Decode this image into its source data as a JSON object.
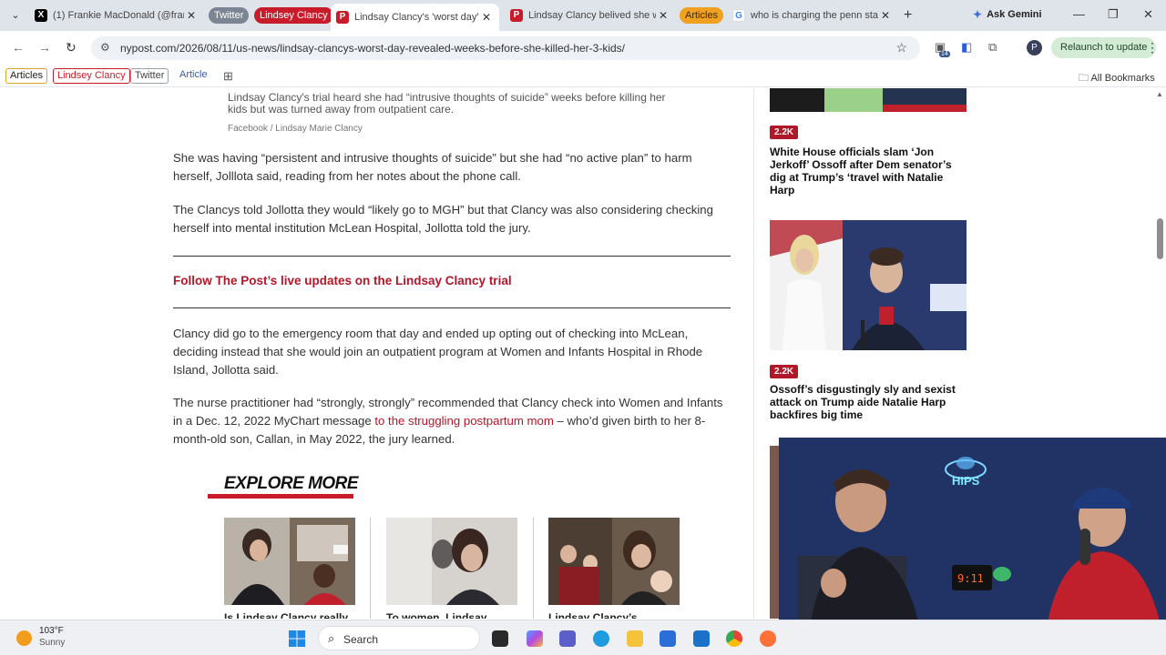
{
  "browser": {
    "tabs": [
      {
        "title": "(1) Frankie MacDonald (@fran",
        "active": false
      },
      {
        "title": "Lindsay Clancy's 'worst day' r",
        "active": true
      },
      {
        "title": "Lindsay Clancy belived she w",
        "active": false
      },
      {
        "title": "who is charging the penn sta",
        "active": false
      }
    ],
    "tab_groups": {
      "twitter": "Twitter",
      "lindsey": "Lindsey Clancy",
      "articles": "Articles"
    },
    "ask_gemini": "Ask Gemini",
    "url": "nypost.com/2026/08/11/us-news/lindsay-clancys-worst-day-revealed-weeks-before-she-killed-her-3-kids/",
    "extension_badge": "14",
    "profile_initial": "P",
    "relaunch_label": "Relaunch to update",
    "bookmarks": [
      "Articles",
      "Lindsey Clancy",
      "Twitter",
      "Article"
    ],
    "all_bookmarks": "All Bookmarks"
  },
  "article": {
    "caption": "Lindsay Clancy's trial heard she had “intrusive thoughts of suicide” weeks before killing her kids but was turned away from outpatient care.",
    "credit": "Facebook / Lindsay Marie Clancy",
    "p1": "She was having “persistent and intrusive thoughts of suicide” but she had “no active plan” to harm herself, Jolllota said, reading from her notes about the phone call.",
    "p2": "The Clancys told Jollotta they would “likely go to MGH” but that Clancy was also considering checking herself into mental institution McLean Hospital, Jollotta told the jury.",
    "follow_link": "Follow The Post’s live updates on the Lindsay Clancy trial",
    "p3": "Clancy did go to the emergency room that day and ended up opting out of checking into McLean, deciding instead that she would join an outpatient program at Women and Infants Hospital in Rhode Island, Jollotta said.",
    "p4_before": "The nurse practitioner had “strongly, strongly” recommended that Clancy check into Women and Infants in a Dec. 12, 2022 MyChart message ",
    "p4_link": "to the struggling postpartum mom",
    "p4_after": " – who’d given birth to her 8-month-old son, Callan, in May 2022, the jury learned.",
    "explore_heading": "EXPLORE MORE",
    "explore_items": [
      {
        "title": "Is Lindsay Clancy really"
      },
      {
        "title": "To women, Lindsay"
      },
      {
        "title": "Lindsay Clancy’s"
      }
    ]
  },
  "sidebar": {
    "items": [
      {
        "badge": "2.2K",
        "title": "White House officials slam ‘Jon Jerkoff’ Ossoff after Dem senator’s dig at Trump’s ‘travel with Natalie Harp"
      },
      {
        "badge": "2.2K",
        "title": "Ossoff’s disgustingly sly and sexist attack on Trump aide Natalie Harp backfires big time"
      }
    ]
  },
  "taskbar": {
    "temperature": "103°F",
    "condition": "Sunny",
    "search_label": "Search"
  },
  "webcam": {
    "neon_sign": "HIPS",
    "clock": "9:11"
  },
  "colors": {
    "accent_red": "#b0182a",
    "tab_strip": "#dfe3ea",
    "relaunch_bg": "#d4ebd6"
  }
}
